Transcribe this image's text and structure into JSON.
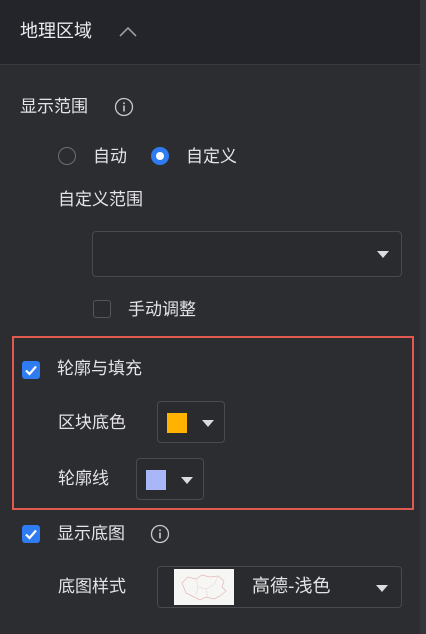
{
  "header": {
    "title": "地理区域",
    "toggle_icon": "chevron-up-icon"
  },
  "display_range": {
    "label": "显示范围",
    "info_icon": "info-icon",
    "options": [
      {
        "label": "自动",
        "selected": false
      },
      {
        "label": "自定义",
        "selected": true
      }
    ],
    "custom_range_label": "自定义范围",
    "custom_range_value": "",
    "manual_adjust_label": "手动调整",
    "manual_adjust_checked": false
  },
  "outline_fill": {
    "label": "轮廓与填充",
    "checked": true,
    "block_color_label": "区块底色",
    "block_color": "#ffb300",
    "outline_label": "轮廓线",
    "outline_color": "#a9b6f7"
  },
  "basemap": {
    "label": "显示底图",
    "checked": true,
    "info_icon": "info-icon",
    "style_label": "底图样式",
    "style_value": "高德-浅色"
  },
  "colors": {
    "accent": "#2f7bf2",
    "highlight_border": "#e05a4f",
    "background": "#2c2d31"
  }
}
